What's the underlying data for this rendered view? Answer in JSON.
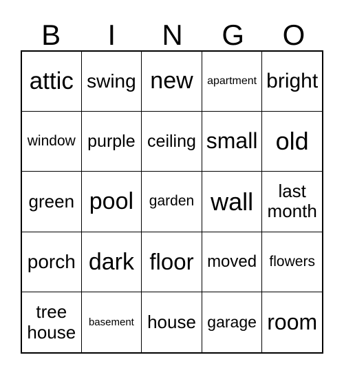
{
  "header": [
    "B",
    "I",
    "N",
    "G",
    "O"
  ],
  "cells": [
    "attic",
    "swing",
    "new",
    "apartment",
    "bright",
    "window",
    "purple",
    "ceiling",
    "small",
    "old",
    "green",
    "pool",
    "garden",
    "wall",
    "last\nmonth",
    "porch",
    "dark",
    "floor",
    "moved",
    "flowers",
    "tree\nhouse",
    "basement",
    "house",
    "garage",
    "room"
  ]
}
